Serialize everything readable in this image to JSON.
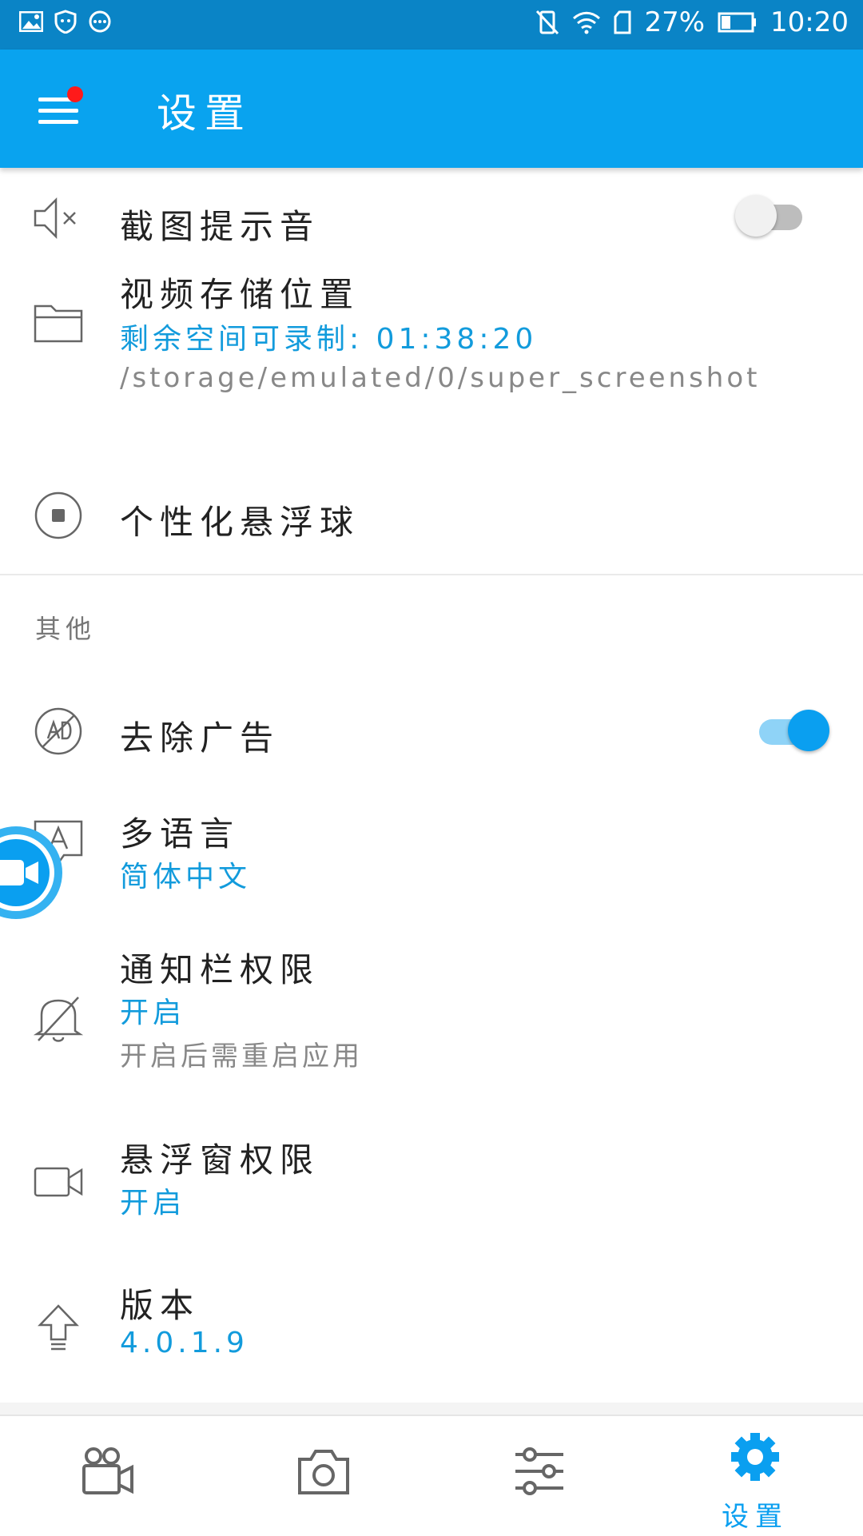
{
  "status_bar": {
    "battery": "27%",
    "time": "10:20"
  },
  "app_bar": {
    "title": "设置"
  },
  "settings": {
    "screenshot_sound": {
      "title": "截图提示音",
      "enabled": false
    },
    "video_storage": {
      "title": "视频存储位置",
      "remaining": "剩余空间可录制: 01:38:20",
      "path": "/storage/emulated/0/super_screenshot"
    },
    "floating_ball": {
      "title": "个性化悬浮球"
    }
  },
  "other": {
    "header": "其他",
    "remove_ads": {
      "title": "去除广告",
      "enabled": true
    },
    "language": {
      "title": "多语言",
      "value": "简体中文"
    },
    "notification_permission": {
      "title": "通知栏权限",
      "value": "开启",
      "note": "开启后需重启应用"
    },
    "overlay_permission": {
      "title": "悬浮窗权限",
      "value": "开启"
    },
    "version": {
      "title": "版本",
      "value": "4.0.1.9"
    }
  },
  "bottom_nav": {
    "active_label": "设置",
    "items": [
      "video-camera-icon",
      "camera-icon",
      "sliders-icon",
      "settings-gear-icon"
    ]
  },
  "colors": {
    "status_bar": "#0a84c6",
    "app_bar": "#09a3ef",
    "accent": "#0a9ff0",
    "subtitle": "#129bdc"
  }
}
